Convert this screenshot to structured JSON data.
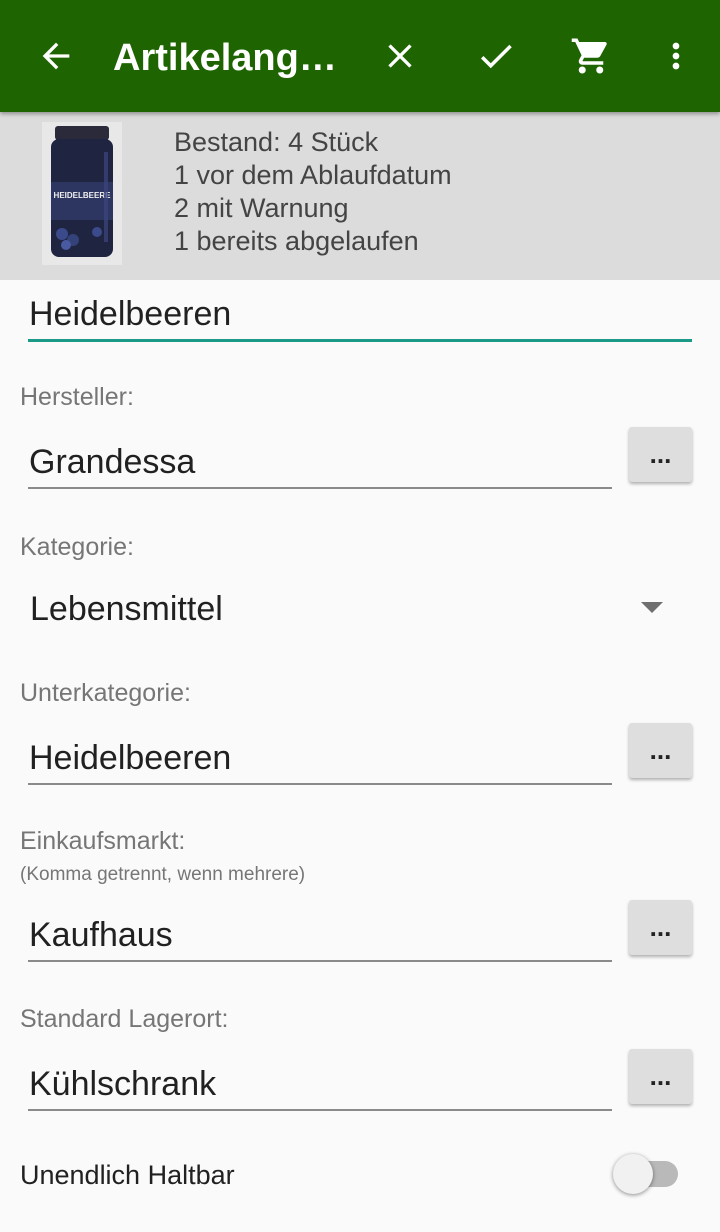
{
  "toolbar": {
    "title": "Artikelangaben",
    "icons": [
      "arrow-back-icon",
      "close-icon",
      "check-icon",
      "cart-icon",
      "more-vert-icon"
    ],
    "background": "#1e6400"
  },
  "stock_info": {
    "line1": "Bestand: 4 Stück",
    "line2": "1 vor dem Ablaufdatum",
    "line3": "2 mit Warnung",
    "line4": "1 bereits abgelaufen",
    "image_label": "HEIDELBEERE"
  },
  "form": {
    "name_value": "Heidelbeeren",
    "hersteller": {
      "label": "Hersteller:",
      "value": "Grandessa",
      "button": "..."
    },
    "kategorie": {
      "label": "Kategorie:",
      "value": "Lebensmittel"
    },
    "unterkategorie": {
      "label": "Unterkategorie:",
      "value": "Heidelbeeren",
      "button": "..."
    },
    "einkaufsmarkt": {
      "label": "Einkaufsmarkt:",
      "hint": "(Komma getrennt, wenn mehrere)",
      "value": "Kaufhaus",
      "button": "..."
    },
    "lagerort": {
      "label": "Standard Lagerort:",
      "value": "Kühlschrank",
      "button": "..."
    },
    "haltbar": {
      "label": "Unendlich Haltbar",
      "checked": false
    }
  },
  "colors": {
    "accent": "#1b9a87",
    "banner": "#dcdcdc"
  }
}
